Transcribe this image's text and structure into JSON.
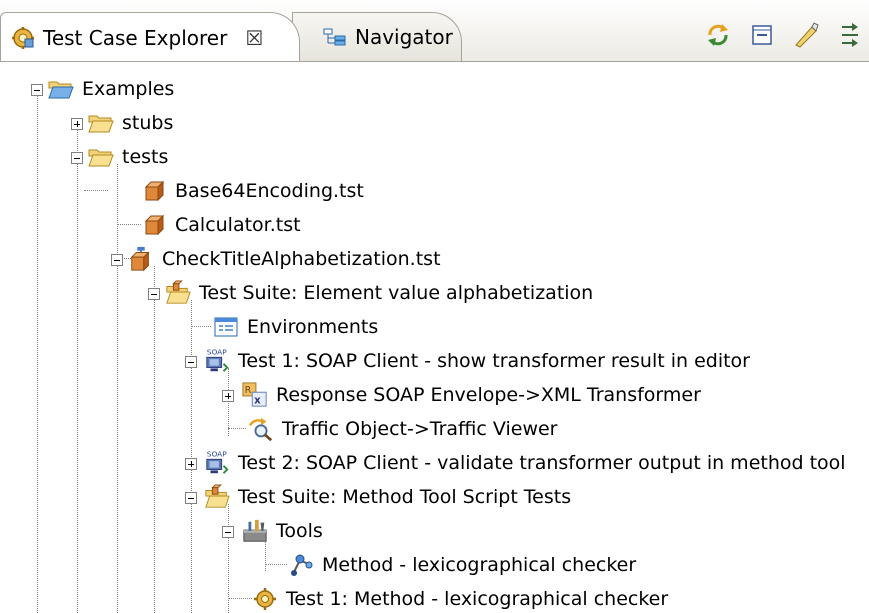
{
  "tabs": {
    "explorer_label": "Test Case Explorer",
    "navigator_label": "Navigator",
    "close_glyph": "☒"
  },
  "toolbar": {
    "icons": [
      "sync-icon",
      "collapse-all-icon",
      "link-editor-icon",
      "more-icon"
    ]
  },
  "tree": {
    "examples": "Examples",
    "stubs": "stubs",
    "tests": "tests",
    "base64": "Base64Encoding.tst",
    "calculator": "Calculator.tst",
    "check_title": "CheckTitleAlphabetization.tst",
    "suite_element": "Test Suite: Element value alphabetization",
    "environments": "Environments",
    "test1_soap": "Test 1: SOAP Client - show transformer result in editor",
    "response_transformer": "Response SOAP Envelope->XML Transformer",
    "traffic_viewer": "Traffic Object->Traffic Viewer",
    "test2_soap": "Test 2: SOAP Client - validate transformer output in method tool",
    "suite_method": "Test Suite: Method Tool Script Tests",
    "tools": "Tools",
    "method_checker": "Method - lexicographical checker",
    "test1_method": "Test 1: Method - lexicographical checker"
  }
}
